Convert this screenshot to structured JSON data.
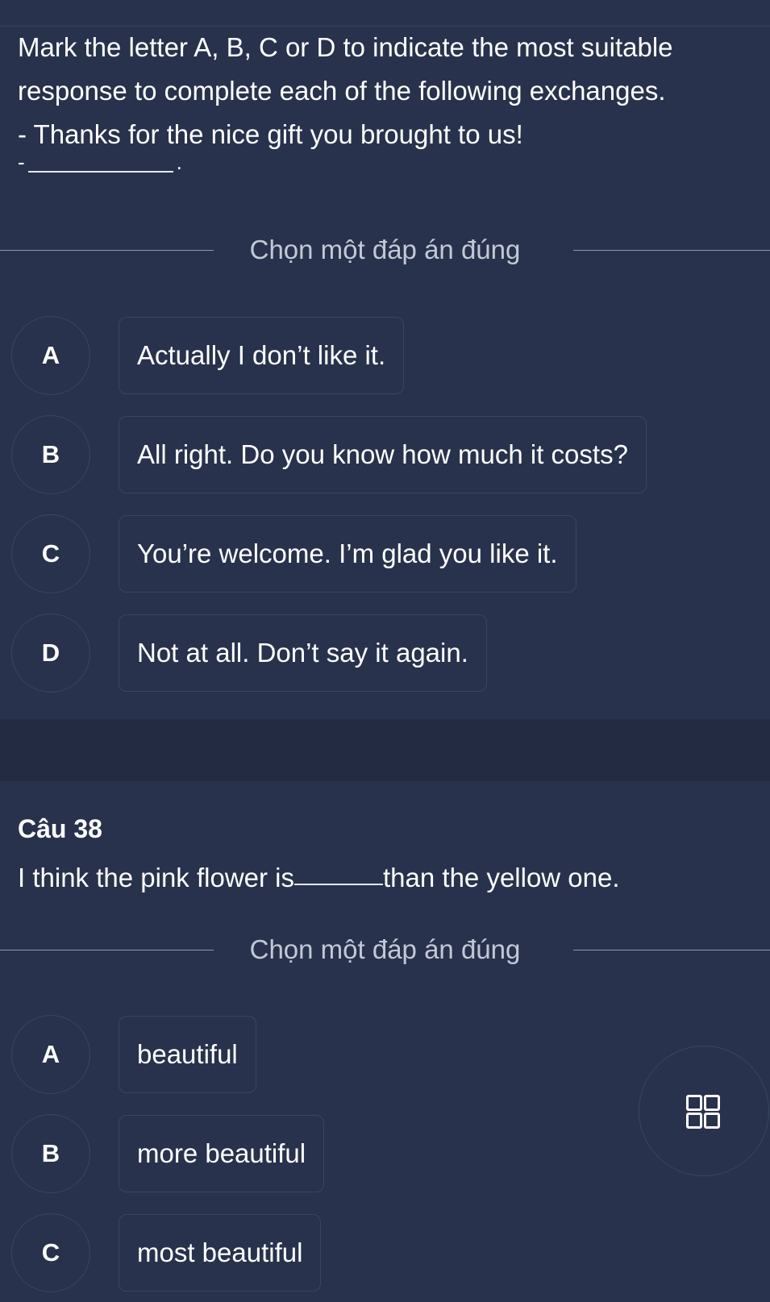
{
  "question1": {
    "prompt_lines": [
      "Mark the letter A, B, C or D to indicate the most suitable",
      "response to complete each of the following exchanges.",
      "- Thanks for the nice gift you brought to us!"
    ],
    "blank_prefix": "-",
    "blank_suffix": ".",
    "instruction": "Chọn một đáp án đúng",
    "options": [
      {
        "letter": "A",
        "text": "Actually I don’t like it."
      },
      {
        "letter": "B",
        "text": "All right. Do you know how much it costs?"
      },
      {
        "letter": "C",
        "text": "You’re welcome. I’m glad you like it."
      },
      {
        "letter": "D",
        "text": "Not at all. Don’t say it again."
      }
    ]
  },
  "question2": {
    "number_label": "Câu 38",
    "prompt_before": "I think the pink flower is",
    "prompt_after": "than the yellow one.",
    "instruction": "Chọn một đáp án đúng",
    "options": [
      {
        "letter": "A",
        "text": "beautiful"
      },
      {
        "letter": "B",
        "text": "more beautiful"
      },
      {
        "letter": "C",
        "text": "most beautiful"
      }
    ]
  },
  "floating_button": {
    "icon": "grid-icon"
  }
}
